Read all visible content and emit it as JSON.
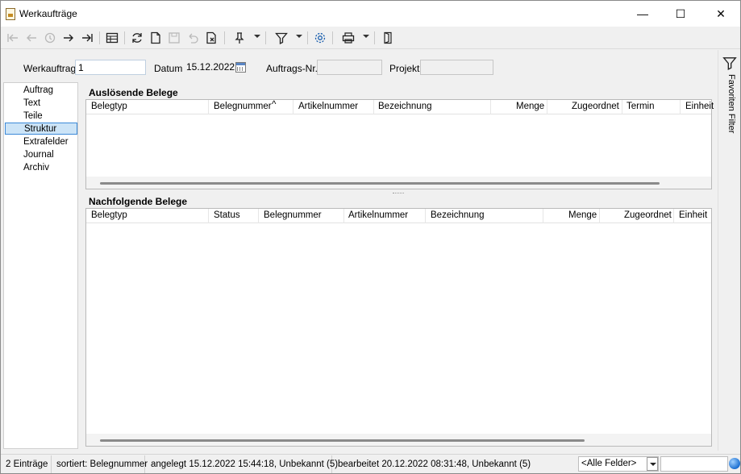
{
  "window": {
    "title": "Werkaufträge",
    "minimize": "—",
    "maximize": "☐",
    "close": "✕"
  },
  "toolbar": {
    "icons": [
      "first-record-icon",
      "previous-record-icon",
      "history-icon",
      "next-record-icon",
      "last-record-icon",
      "table-view-icon",
      "refresh-icon",
      "new-document-icon",
      "save-icon",
      "undo-icon",
      "delete-document-icon",
      "pin-icon",
      "filter-icon",
      "settings-icon",
      "print-icon",
      "exit-icon"
    ]
  },
  "form": {
    "werkauftrag_label": "Werkauftrag",
    "werkauftrag_value": "1",
    "datum_label": "Datum",
    "datum_value": "15.12.2022",
    "auftragsnr_label": "Auftrags-Nr.",
    "auftragsnr_value": "",
    "projekt_label": "Projekt",
    "projekt_value": ""
  },
  "nav": {
    "items": [
      {
        "label": "Auftrag"
      },
      {
        "label": "Text"
      },
      {
        "label": "Teile"
      },
      {
        "label": "Struktur",
        "selected": true
      },
      {
        "label": "Extrafelder"
      },
      {
        "label": "Journal"
      },
      {
        "label": "Archiv"
      }
    ]
  },
  "right_panel": {
    "label": "Favoriten Filter"
  },
  "ausloesende": {
    "title": "Auslösende Belege",
    "columns": [
      "Belegtyp",
      "Belegnummer",
      "Artikelnummer",
      "Bezeichnung",
      "Menge",
      "Zugeordnet",
      "Termin",
      "Einheit"
    ],
    "sort_indicator": "^"
  },
  "nachfolgende": {
    "title": "Nachfolgende Belege",
    "columns": [
      "Belegtyp",
      "Status",
      "Belegnummer",
      "Artikelnummer",
      "Bezeichnung",
      "Menge",
      "Zugeordnet",
      "Einheit"
    ]
  },
  "status": {
    "count": "2 Einträge",
    "sort": "sortiert: Belegnummer",
    "created": "angelegt 15.12.2022 15:44:18, Unbekannt (5)",
    "edited": "bearbeitet 20.12.2022 08:31:48, Unbekannt (5)",
    "field_select": "<Alle Felder>"
  }
}
